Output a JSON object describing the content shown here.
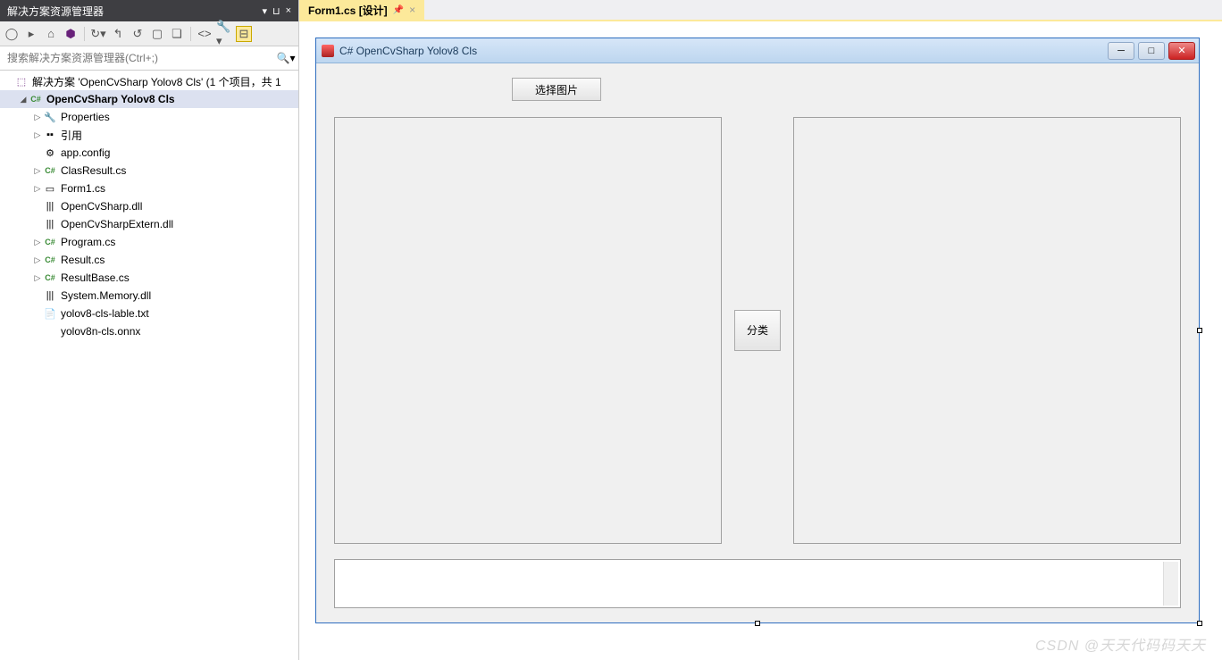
{
  "panel": {
    "title": "解决方案资源管理器",
    "search_placeholder": "搜索解决方案资源管理器(Ctrl+;)",
    "solution_label": "解决方案 'OpenCvSharp Yolov8 Cls' (1 个项目，共 1",
    "project_label": "OpenCvSharp Yolov8 Cls",
    "items": {
      "properties": "Properties",
      "references": "引用",
      "appconfig": "app.config",
      "clasresult": "ClasResult.cs",
      "form1": "Form1.cs",
      "opencv_dll": "OpenCvSharp.dll",
      "opencv_extern": "OpenCvSharpExtern.dll",
      "program": "Program.cs",
      "result": "Result.cs",
      "resultbase": "ResultBase.cs",
      "sysmem": "System.Memory.dll",
      "labeltxt": "yolov8-cls-lable.txt",
      "onnx": "yolov8n-cls.onnx"
    }
  },
  "tab": {
    "label": "Form1.cs [设计]"
  },
  "form": {
    "title": "C# OpenCvSharp Yolov8 Cls",
    "select_button": "选择图片",
    "classify_button": "分类"
  },
  "watermark": "CSDN @天天代码码天天"
}
